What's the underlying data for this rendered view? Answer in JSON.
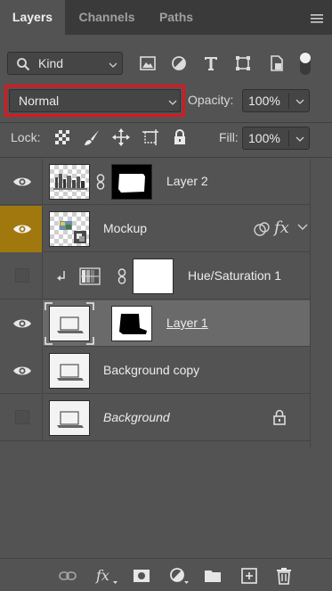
{
  "tabs": [
    {
      "label": "Layers",
      "active": true
    },
    {
      "label": "Channels",
      "active": false
    },
    {
      "label": "Paths",
      "active": false
    }
  ],
  "filter": {
    "kind_label": "Kind",
    "icons": [
      "image-filter-icon",
      "adjustment-filter-icon",
      "type-filter-icon",
      "shape-filter-icon",
      "smart-object-filter-icon",
      "filter-toggle-icon"
    ]
  },
  "blend": {
    "mode": "Normal",
    "opacity_label": "Opacity:",
    "opacity_value": "100%",
    "highlight_color": "#e0151d"
  },
  "lock": {
    "label": "Lock:",
    "icons": [
      "lock-transparent-icon",
      "lock-image-icon",
      "lock-position-icon",
      "lock-artboard-icon",
      "lock-all-icon"
    ],
    "fill_label": "Fill:",
    "fill_value": "100%"
  },
  "layers": [
    {
      "name": "Layer 2",
      "visible": true,
      "has_mask": true
    },
    {
      "name": "Mockup",
      "visible": true,
      "selected_eye": true,
      "fx": "fx"
    },
    {
      "name": "Hue/Saturation 1",
      "visible": false,
      "adjustment": true,
      "has_mask": true
    },
    {
      "name": "Layer 1",
      "visible": true,
      "selected": true,
      "has_mask": true
    },
    {
      "name": "Background copy",
      "visible": true
    },
    {
      "name": "Background",
      "visible": false,
      "locked": true
    }
  ],
  "bottom_icons": [
    "link-layers-icon",
    "fx-icon",
    "add-mask-icon",
    "new-adjustment-icon",
    "new-group-icon",
    "new-layer-icon",
    "delete-layer-icon"
  ],
  "colors": {
    "panel": "#535353",
    "tabbar": "#3a3a3a",
    "selected_row": "#6a6a6a",
    "eye_highlight": "#a0780e"
  }
}
